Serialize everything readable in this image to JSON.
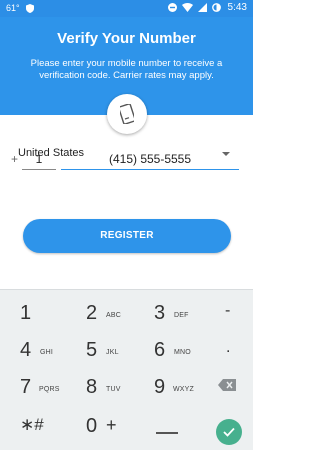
{
  "status_bar": {
    "temperature": "61°",
    "time": "5:43"
  },
  "header": {
    "title": "Verify Your Number",
    "subtitle": "Please enter your mobile number to receive a verification code. Carrier rates may apply."
  },
  "form": {
    "country": "United States",
    "plus": "+",
    "country_code": "1",
    "phone_number": "(415) 555-5555",
    "register_label": "REGISTER"
  },
  "keypad": {
    "keys": [
      {
        "num": "1",
        "letters": ""
      },
      {
        "num": "2",
        "letters": "ABC"
      },
      {
        "num": "3",
        "letters": "DEF"
      },
      {
        "num": "4",
        "letters": "GHI"
      },
      {
        "num": "5",
        "letters": "JKL"
      },
      {
        "num": "6",
        "letters": "MNO"
      },
      {
        "num": "7",
        "letters": "PQRS"
      },
      {
        "num": "8",
        "letters": "TUV"
      },
      {
        "num": "9",
        "letters": "WXYZ"
      },
      {
        "num": "0",
        "letters": "+"
      }
    ],
    "dash": "-",
    "dot": ".",
    "star_hash": "∗#"
  },
  "icons": {
    "shield": "shield-icon",
    "wifi": "wifi-icon",
    "battery": "battery-icon",
    "phone": "smartphone-icon",
    "backspace": "backspace-icon",
    "check": "check-icon"
  },
  "colors": {
    "primary": "#2e94ea",
    "status_bar": "#2c8ee6",
    "keypad_bg": "#edf0f1",
    "confirm": "#47b08e"
  }
}
